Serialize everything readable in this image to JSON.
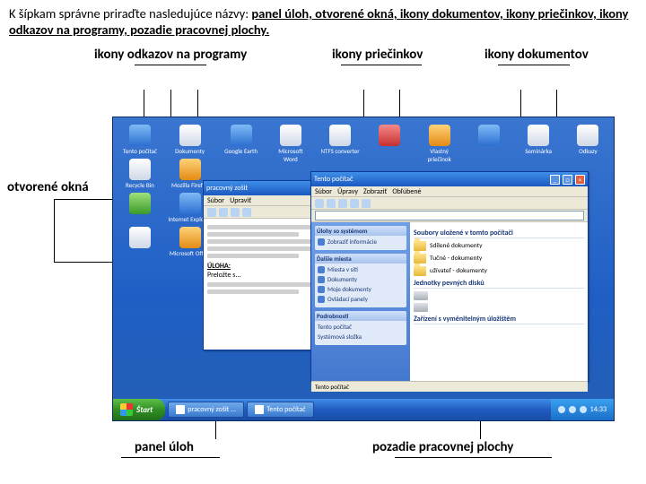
{
  "instruction": {
    "lead": "K šípkam správne priraďte nasledujúce názvy: ",
    "terms": "panel úloh, otvorené okná, ikony dokumentov, ikony priečinkov, ikony odkazov na programy, pozadie pracovnej plochy."
  },
  "labels": {
    "programs": "ikony odkazov na programy",
    "folders": "ikony priečinkov",
    "documents": "ikony dokumentov",
    "openWindows": "otvorené okná",
    "taskbar": "panel úloh",
    "background": "pozadie pracovnej plochy"
  },
  "desktop": {
    "leftIcons": [
      "Tento počítač",
      "Dokumenty",
      "Recycle Bin",
      "Mozilla Firefox",
      "",
      "Internet Explorer",
      "",
      "Microsoft Office"
    ],
    "topIcons": [
      "Google Earth",
      "Microsoft Word",
      "NTFS converter",
      "",
      "Vlastný priečinok",
      "",
      "Seminárka",
      "Odkazy"
    ]
  },
  "taskbar": {
    "start": "Štart",
    "items": [
      "pracovný zošit ...",
      "Tento počítač"
    ],
    "clock": "14:33"
  },
  "window1": {
    "title": "pracovný zošit",
    "menu": [
      "Súbor",
      "Upraviť"
    ],
    "heading": "ÚLOHA:",
    "sub": "Preložte s..."
  },
  "window2": {
    "title": "Tento počítač",
    "menu": [
      "Súbor",
      "Úpravy",
      "Zobraziť",
      "Obľúbené"
    ],
    "sidepanel": {
      "block1": {
        "head": "Úlohy so systémom",
        "items": [
          "Zobraziť informácie"
        ]
      },
      "block2": {
        "head": "Ďalšie miesta",
        "items": [
          "Miesta v síti",
          "Dokumenty",
          "Moje dokumenty",
          "Ovládací panely"
        ]
      },
      "block3": {
        "head": "Podrobnosti",
        "items": [
          "Tento počítač",
          "Systémová složka"
        ]
      }
    },
    "main": {
      "group1": "Soubory uložené v tomto počítači",
      "folders": [
        "Sdílené dokumenty",
        "Tučné - dokumenty",
        "užívateľ - dokumenty"
      ],
      "group2": "Jednotky pevných disků",
      "group3": "Zařízení s vyměnitelným úložištěm"
    },
    "status": "Tento počítač"
  }
}
